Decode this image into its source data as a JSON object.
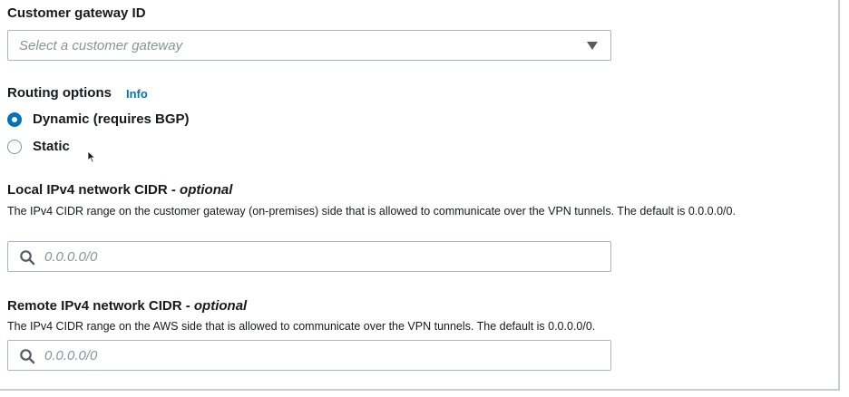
{
  "customer_gateway": {
    "label": "Customer gateway ID",
    "placeholder": "Select a customer gateway"
  },
  "routing": {
    "label": "Routing options",
    "info": "Info",
    "options": [
      {
        "label": "Dynamic (requires BGP)",
        "selected": true
      },
      {
        "label": "Static",
        "selected": false
      }
    ]
  },
  "local_cidr": {
    "label": "Local IPv4 network CIDR - ",
    "optional": "optional",
    "description": "The IPv4 CIDR range on the customer gateway (on-premises) side that is allowed to communicate over the VPN tunnels. The default is 0.0.0.0/0.",
    "placeholder": "0.0.0.0/0"
  },
  "remote_cidr": {
    "label": "Remote IPv4 network CIDR - ",
    "optional": "optional",
    "description": "The IPv4 CIDR range on the AWS side that is allowed to communicate over the VPN tunnels. The default is 0.0.0.0/0.",
    "placeholder": "0.0.0.0/0"
  },
  "colors": {
    "accent": "#0073bb",
    "border": "#aab7b8",
    "placeholder": "#879596"
  }
}
